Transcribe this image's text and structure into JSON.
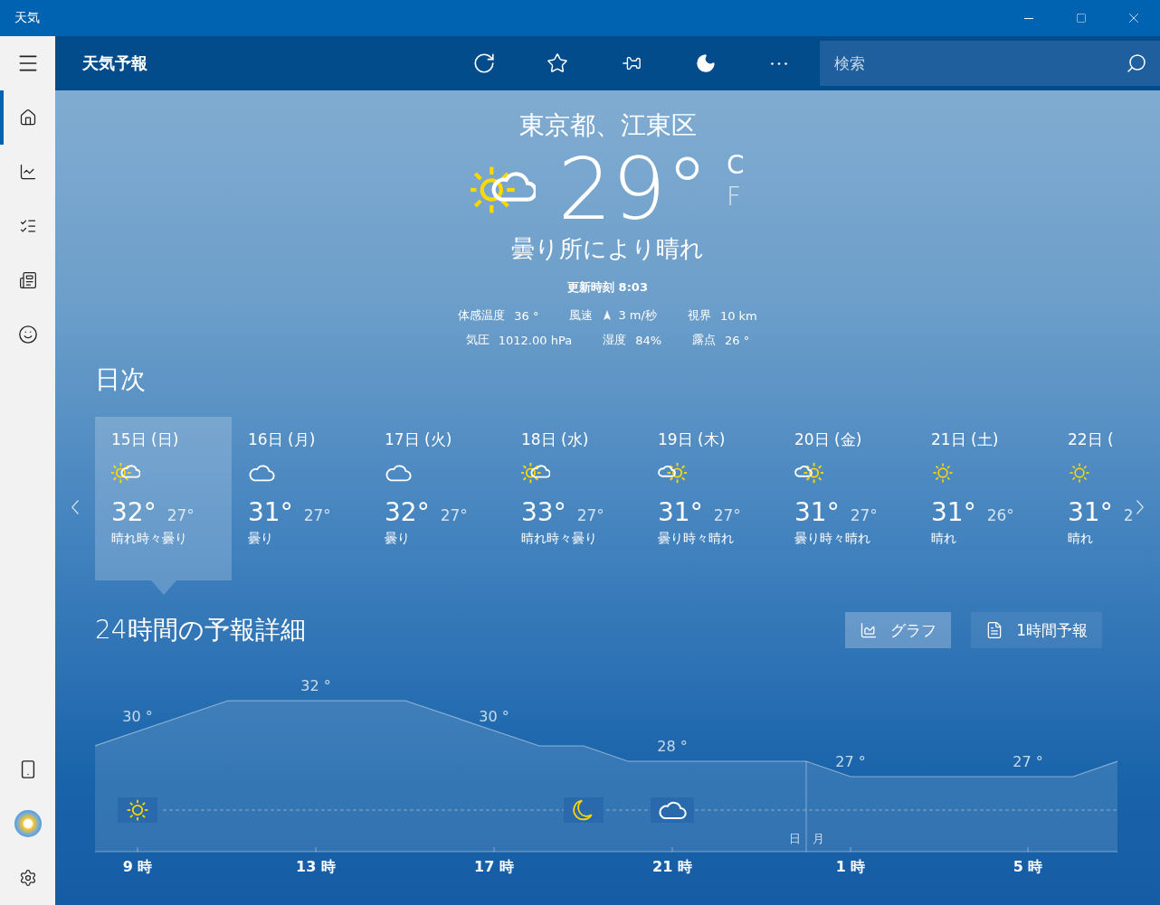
{
  "window": {
    "title": "天気"
  },
  "header": {
    "title": "天気予報",
    "search": {
      "placeholder": "検索"
    }
  },
  "sidebar": {
    "items": [
      {
        "kind": "home",
        "selected": true
      },
      {
        "kind": "chart",
        "selected": false
      },
      {
        "kind": "favorites",
        "selected": false
      },
      {
        "kind": "news",
        "selected": false
      },
      {
        "kind": "smile",
        "selected": false
      }
    ]
  },
  "current": {
    "location": "東京都、江東区",
    "kind": "sun-cloud",
    "temperature": "29°",
    "units": [
      {
        "label": "C",
        "selected": true
      },
      {
        "label": "F",
        "selected": false
      }
    ],
    "condition": "曇り所により晴れ",
    "updated": "更新時刻 8:03",
    "details": [
      [
        {
          "kind": "plain",
          "label": "体感温度",
          "value": "36 °"
        },
        {
          "kind": "wind",
          "label": "風速",
          "value": "3 m/秒"
        },
        {
          "kind": "plain",
          "label": "視界",
          "value": "10 km"
        }
      ],
      [
        {
          "kind": "plain",
          "label": "気圧",
          "value": "1012.00 hPa"
        },
        {
          "kind": "plain",
          "label": "湿度",
          "value": "84%"
        },
        {
          "kind": "plain",
          "label": "露点",
          "value": "26 °"
        }
      ]
    ]
  },
  "daily": {
    "title": "日次",
    "days": [
      {
        "date": "15日 (日)",
        "kind": "sun-cloud",
        "high": "32°",
        "low": "27°",
        "condition": "晴れ時々曇り",
        "selected": true
      },
      {
        "date": "16日 (月)",
        "kind": "cloud",
        "high": "31°",
        "low": "27°",
        "condition": "曇り",
        "selected": false
      },
      {
        "date": "17日 (火)",
        "kind": "cloud",
        "high": "32°",
        "low": "27°",
        "condition": "曇り",
        "selected": false
      },
      {
        "date": "18日 (水)",
        "kind": "sun-cloud",
        "high": "33°",
        "low": "27°",
        "condition": "晴れ時々曇り",
        "selected": false
      },
      {
        "date": "19日 (木)",
        "kind": "cloud-sun",
        "high": "31°",
        "low": "27°",
        "condition": "曇り時々晴れ",
        "selected": false
      },
      {
        "date": "20日 (金)",
        "kind": "cloud-sun",
        "high": "31°",
        "low": "27°",
        "condition": "曇り時々晴れ",
        "selected": false
      },
      {
        "date": "21日 (土)",
        "kind": "sun",
        "high": "31°",
        "low": "26°",
        "condition": "晴れ",
        "selected": false
      },
      {
        "date": "22日 (",
        "kind": "sun",
        "high": "31°",
        "low": "2",
        "condition": "晴れ",
        "selected": false
      }
    ]
  },
  "hourly": {
    "title": "24時間の予報詳細",
    "views": [
      {
        "kind": "graph",
        "label": "グラフ",
        "selected": true
      },
      {
        "kind": "list",
        "label": "1時間予報",
        "selected": false
      }
    ],
    "temperature_labels": [
      "30 °",
      "32 °",
      "30 °",
      "28 °",
      "27 °",
      "27 °"
    ],
    "conditions": [
      {
        "kind": "sun"
      },
      {
        "kind": "moon"
      },
      {
        "kind": "cloud"
      }
    ],
    "day_markers": [
      "日",
      "月"
    ],
    "hours": [
      "9 時",
      "13 時",
      "17 時",
      "21 時",
      "1 時",
      "5 時"
    ]
  }
}
